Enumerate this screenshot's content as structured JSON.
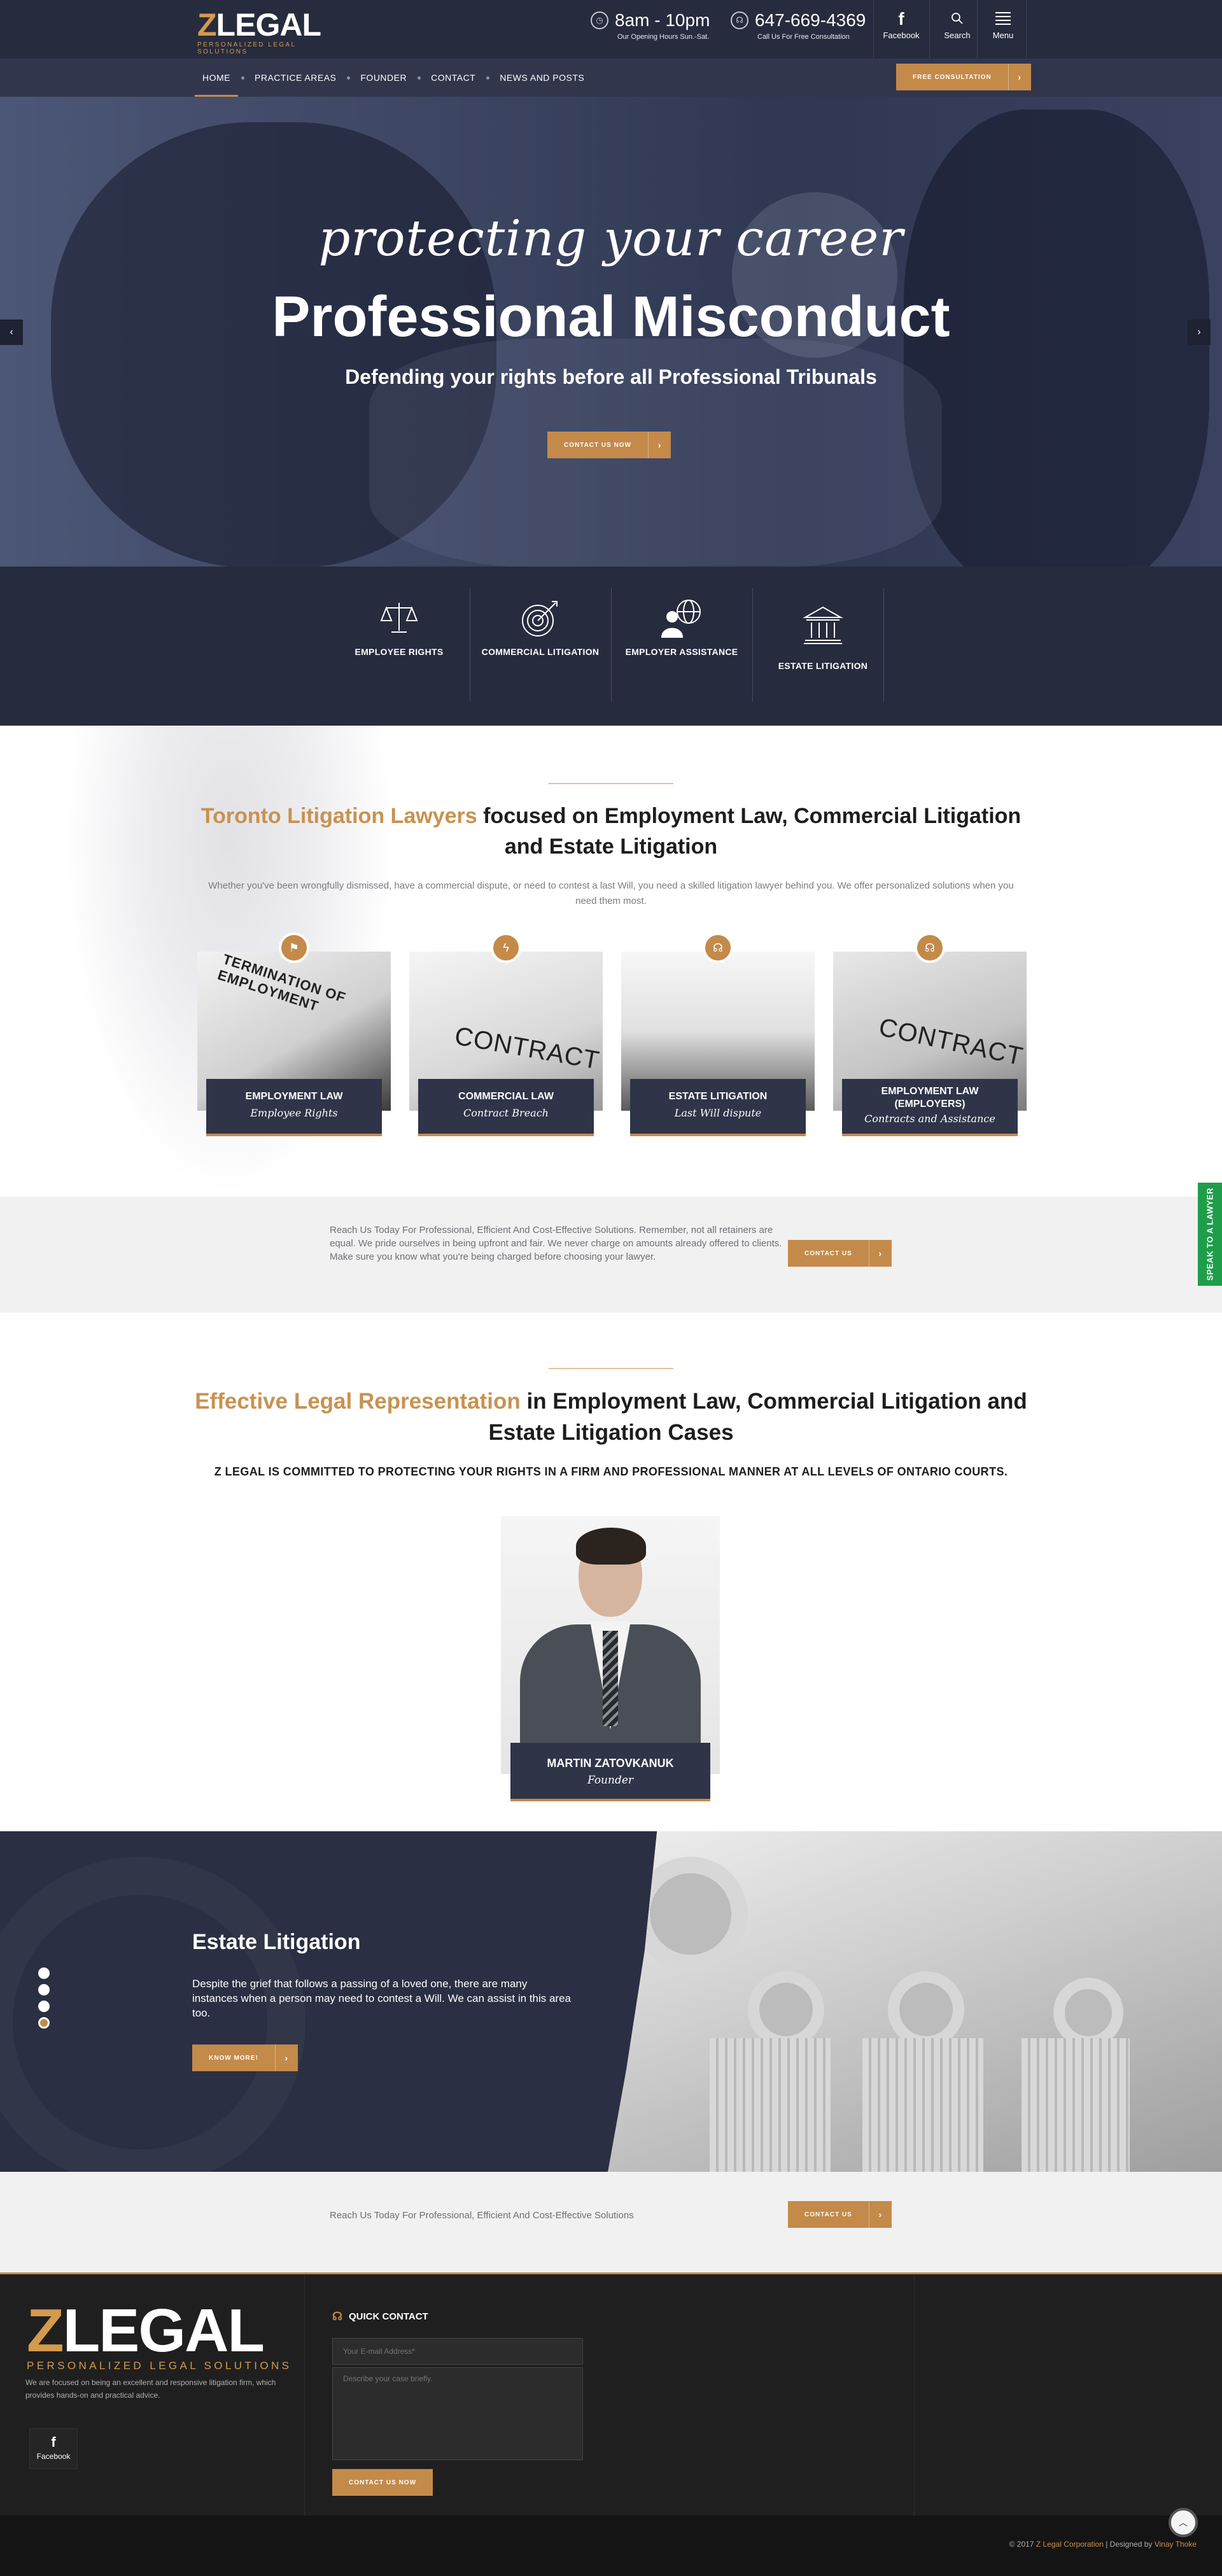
{
  "header": {
    "logo_mark": "LEGAL",
    "logo_initial": "Z",
    "logo_tagline": "PERSONALIZED LEGAL SOLUTIONS",
    "hours": "8am - 10pm",
    "hours_caption": "Our Opening Hours Sun.-Sat.",
    "phone": "647-669-4369",
    "phone_caption": "Call Us For Free Consultation",
    "facebook_label": "Facebook",
    "search_label": "Search",
    "menu_label": "Menu"
  },
  "nav": {
    "items": [
      "HOME",
      "PRACTICE AREAS",
      "FOUNDER",
      "CONTACT",
      "NEWS AND POSTS"
    ],
    "cta": "FREE CONSULTATION"
  },
  "hero": {
    "script": "protecting your career",
    "title": "Professional Misconduct",
    "subtitle": "Defending your rights before all Professional Tribunals",
    "button": "CONTACT US NOW"
  },
  "features": [
    "EMPLOYEE RIGHTS",
    "COMMERCIAL LITIGATION",
    "EMPLOYER ASSISTANCE",
    "ESTATE LITIGATION"
  ],
  "intro": {
    "title_highlight": "Toronto Litigation Lawyers",
    "title_rest": " focused on Employment Law, Commercial Litigation and Estate Litigation",
    "lead": "Whether you've been wrongfully dismissed, have a commercial dispute, or need to contest a last Will, you need a skilled litigation lawyer behind you. We offer personalized solutions when you need them most.",
    "cards": [
      {
        "title": "EMPLOYMENT LAW",
        "subtitle": "Employee Rights",
        "image_text": "TERMINATION OF EMPLOYMENT"
      },
      {
        "title": "COMMERCIAL LAW",
        "subtitle": "Contract Breach",
        "image_text": "CONTRACT"
      },
      {
        "title": "ESTATE LITIGATION",
        "subtitle": "Last Will dispute",
        "image_text": ""
      },
      {
        "title": "EMPLOYMENT LAW (EMPLOYERS)",
        "subtitle": "Contracts and Assistance",
        "image_text": "CONTRACT"
      }
    ]
  },
  "cta1": {
    "text": "Reach Us Today For Professional, Efficient And Cost-Effective Solutions. Remember, not all retainers are equal. We pride ourselves in being upfront and fair.  We never charge on amounts already offered to clients. Make sure you know what you're being charged before choosing your lawyer.",
    "button": "CONTACT US"
  },
  "rep": {
    "title_highlight": "Effective Legal Representation",
    "title_rest": " in Employment Law, Commercial Litigation and Estate Litigation Cases",
    "commitment": "Z LEGAL IS COMMITTED TO PROTECTING YOUR RIGHTS IN A FIRM AND PROFESSIONAL MANNER AT ALL LEVELS OF ONTARIO COURTS.",
    "name": "MARTIN ZATOVKANUK",
    "role": "Founder"
  },
  "slider": {
    "title": "Estate Litigation",
    "text": "Despite the grief that follows a passing of a loved one, there are many instances when a person may need to contest a Will. We can assist in this area too.",
    "button": "KNOW MORE!",
    "active_dot": 4,
    "dot_count": 4
  },
  "cta2": {
    "text": "Reach Us Today For Professional, Efficient And Cost-Effective Solutions",
    "button": "CONTACT US"
  },
  "footer": {
    "about": "We are focused on being an excellent and responsive litigation firm, which provides hands-on and practical advice.",
    "facebook_label": "Facebook",
    "quick_contact": "QUICK CONTACT",
    "email_placeholder": "Your E-mail Address*",
    "message_placeholder": "Describe your case briefly.",
    "submit": "CONTACT US NOW",
    "copyright_prefix": "© 2017 ",
    "company": "Z Legal Corporation",
    "designed_by": " | Designed by ",
    "designer": "Vinay Thoke"
  },
  "side_tab": "SPEAK TO A LAWYER",
  "colors": {
    "navy": "#272b3e",
    "gold": "#c48a4a",
    "green": "#1e9e4a"
  }
}
